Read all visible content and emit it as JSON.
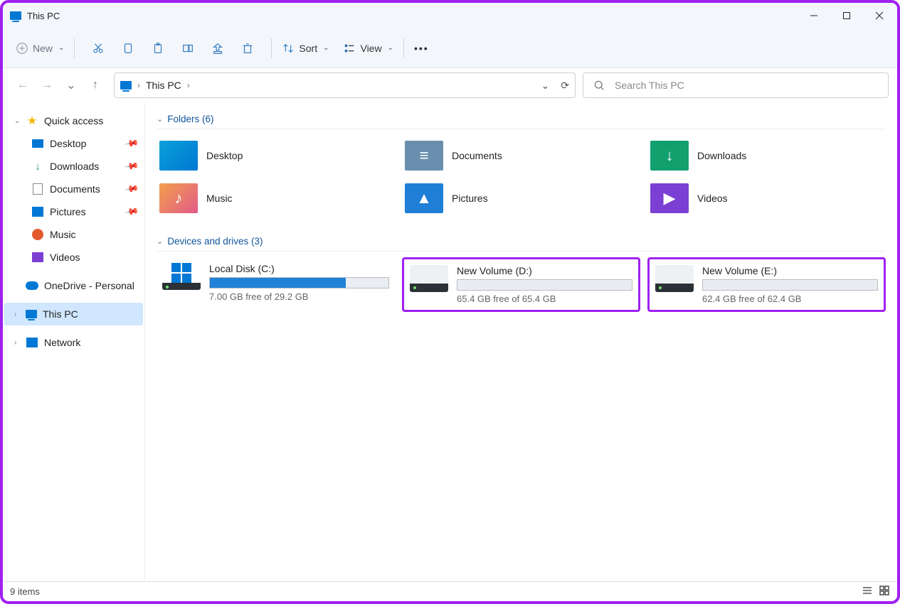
{
  "window": {
    "title": "This PC"
  },
  "toolbar": {
    "new": "New",
    "sort": "Sort",
    "view": "View"
  },
  "address": {
    "location": "This PC"
  },
  "search": {
    "placeholder": "Search This PC"
  },
  "sidebar": {
    "quick_access": "Quick access",
    "desktop": "Desktop",
    "downloads": "Downloads",
    "documents": "Documents",
    "pictures": "Pictures",
    "music": "Music",
    "videos": "Videos",
    "onedrive": "OneDrive - Personal",
    "this_pc": "This PC",
    "network": "Network"
  },
  "sections": {
    "folders_label": "Folders (6)",
    "drives_label": "Devices and drives (3)"
  },
  "folders": {
    "desktop": "Desktop",
    "documents": "Documents",
    "downloads": "Downloads",
    "music": "Music",
    "pictures": "Pictures",
    "videos": "Videos"
  },
  "drives": [
    {
      "name": "Local Disk (C:)",
      "free": "7.00 GB free of 29.2 GB",
      "fill_pct": 76,
      "highlight": false,
      "win": true
    },
    {
      "name": "New Volume (D:)",
      "free": "65.4 GB free of 65.4 GB",
      "fill_pct": 0,
      "highlight": true,
      "win": false
    },
    {
      "name": "New Volume (E:)",
      "free": "62.4 GB free of 62.4 GB",
      "fill_pct": 0,
      "highlight": true,
      "win": false
    }
  ],
  "status": {
    "items": "9 items"
  }
}
